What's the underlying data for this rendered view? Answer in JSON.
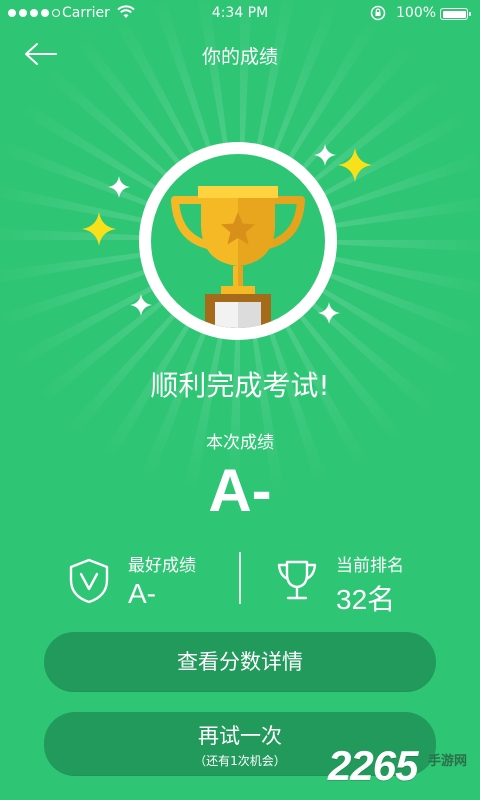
{
  "status_bar": {
    "carrier": "Carrier",
    "time": "4:34 PM",
    "battery": "100%"
  },
  "header": {
    "title": "你的成绩"
  },
  "result": {
    "message": "顺利完成考试!",
    "current_label": "本次成绩",
    "current_grade": "A-"
  },
  "stats": {
    "best_label": "最好成绩",
    "best_value": "A-",
    "rank_label": "当前排名",
    "rank_value": "32名"
  },
  "buttons": {
    "detail": "查看分数详情",
    "retry": "再试一次",
    "retry_note": "（还有1次机会）"
  },
  "watermark": {
    "number": "2265",
    "text": "手游网"
  },
  "colors": {
    "background": "#2ec574",
    "button": "#229a5c",
    "trophy_gold": "#f5b925"
  },
  "icons": {
    "back": "back-arrow-icon",
    "trophy": "trophy-icon",
    "shield": "shield-check-icon",
    "rank": "trophy-outline-icon",
    "sparkle": "sparkle-icon"
  }
}
